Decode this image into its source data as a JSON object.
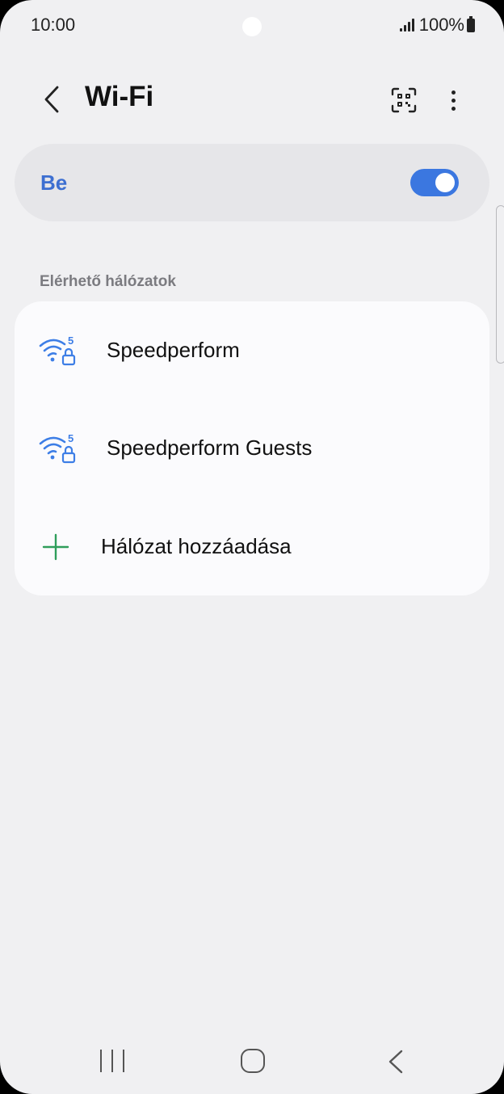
{
  "status_bar": {
    "time": "10:00",
    "battery": "100%"
  },
  "header": {
    "title": "Wi-Fi",
    "back_icon": "chevron-left-icon",
    "qr_icon": "qr-scan-icon",
    "more_icon": "more-vert-icon"
  },
  "toggle": {
    "label": "Be",
    "state": true,
    "accent_color": "#3b77e0"
  },
  "section": {
    "title": "Elérhető hálózatok"
  },
  "networks": [
    {
      "name": "Speedperform",
      "icon": "wifi-5ghz-locked-icon"
    },
    {
      "name": "Speedperform Guests",
      "icon": "wifi-5ghz-locked-icon"
    }
  ],
  "add_network": {
    "label": "Hálózat hozzáadása",
    "icon": "plus-icon",
    "icon_color": "#2f9e5b"
  },
  "navigation": {
    "recents_icon": "recents-icon",
    "home_icon": "home-icon",
    "back_icon": "back-icon"
  }
}
